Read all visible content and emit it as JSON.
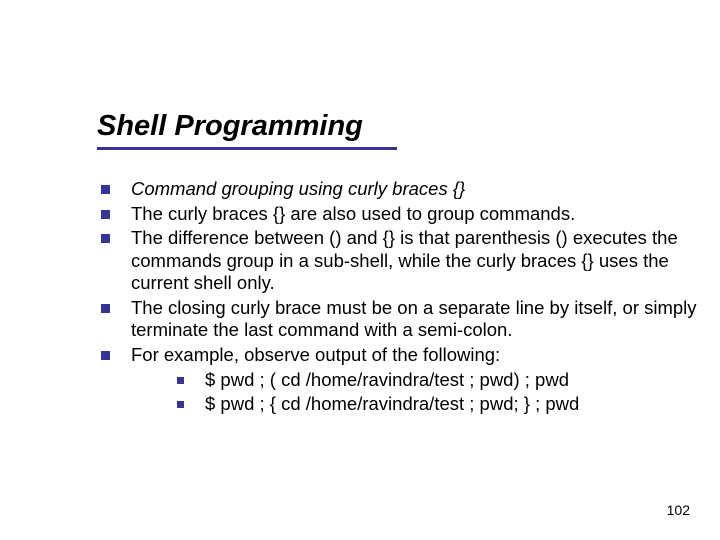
{
  "title": "Shell Programming",
  "items": [
    {
      "text": "Command grouping using curly braces {}",
      "italic": true
    },
    {
      "text": "The curly braces {} are also used to group commands."
    },
    {
      "text": "The difference between () and {} is that parenthesis () executes the commands group in a sub-shell, while the curly braces {} uses the current shell only."
    },
    {
      "text": "The closing curly brace must be on a separate line by itself, or simply terminate the last command with a semi-colon."
    },
    {
      "text": "For example, observe output of the following:",
      "sub": [
        "$ pwd ; ( cd /home/ravindra/test ; pwd) ; pwd",
        "$ pwd ; { cd /home/ravindra/test ; pwd; } ; pwd"
      ]
    }
  ],
  "page_number": "102"
}
